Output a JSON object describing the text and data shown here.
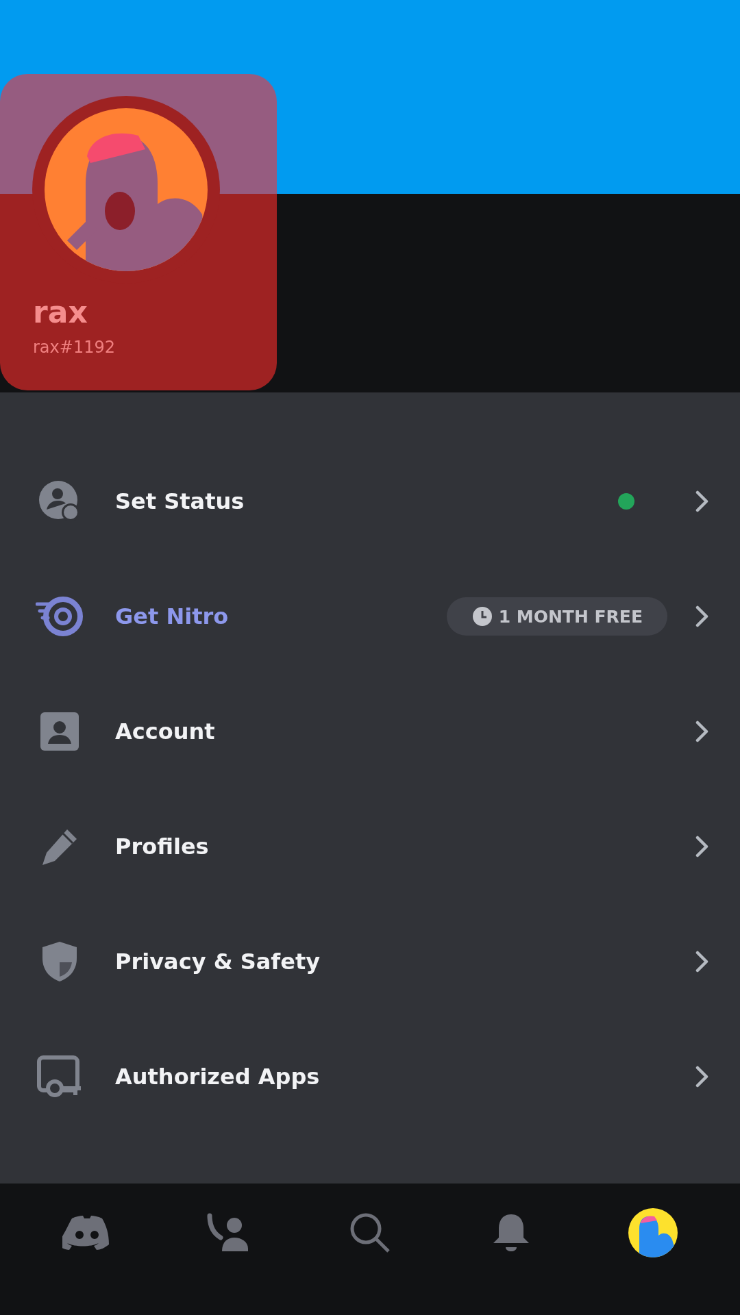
{
  "profile": {
    "display_name": "rax",
    "username": "rax#1192"
  },
  "menu": [
    {
      "kind": "status",
      "label": "Set Status",
      "color": "#23a55a"
    },
    {
      "kind": "nitro",
      "label": "Get Nitro",
      "badge": "1 MONTH FREE"
    },
    {
      "kind": "account",
      "label": "Account"
    },
    {
      "kind": "profiles",
      "label": "Profiles"
    },
    {
      "kind": "privacy",
      "label": "Privacy & Safety"
    },
    {
      "kind": "apps",
      "label": "Authorized Apps"
    }
  ],
  "nav": [
    {
      "kind": "home"
    },
    {
      "kind": "friends"
    },
    {
      "kind": "search"
    },
    {
      "kind": "notifications"
    },
    {
      "kind": "you"
    }
  ]
}
